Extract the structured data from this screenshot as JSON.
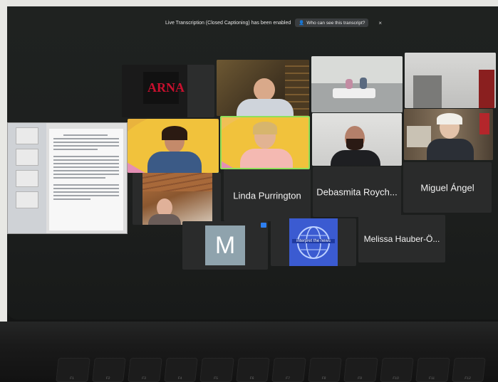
{
  "banner": {
    "text": "Live Transcription (Closed Captioning) has been enabled",
    "button_label": "Who can see this transcript?",
    "close_symbol": "×"
  },
  "logo_text": "ARNA",
  "participants": {
    "linda": "Linda Purrington",
    "debasmita": "Debasmita Roych...",
    "miguel": "Miguel Ángel",
    "m_initial": "M",
    "melissa": "Melissa Hauber-Ö..."
  },
  "interpreter_logo_text": "interpret the news",
  "keyboard": {
    "labels": [
      "F1",
      "F2",
      "F3",
      "F4",
      "F5",
      "F6",
      "F7",
      "F8",
      "F9",
      "F10",
      "F11",
      "F12"
    ]
  },
  "colors": {
    "tile_bg": "#2a2b2b",
    "active_speaker_border": "#8fe05a",
    "logo_red": "#c8102e",
    "interpret_blue": "#3b5bd1"
  }
}
